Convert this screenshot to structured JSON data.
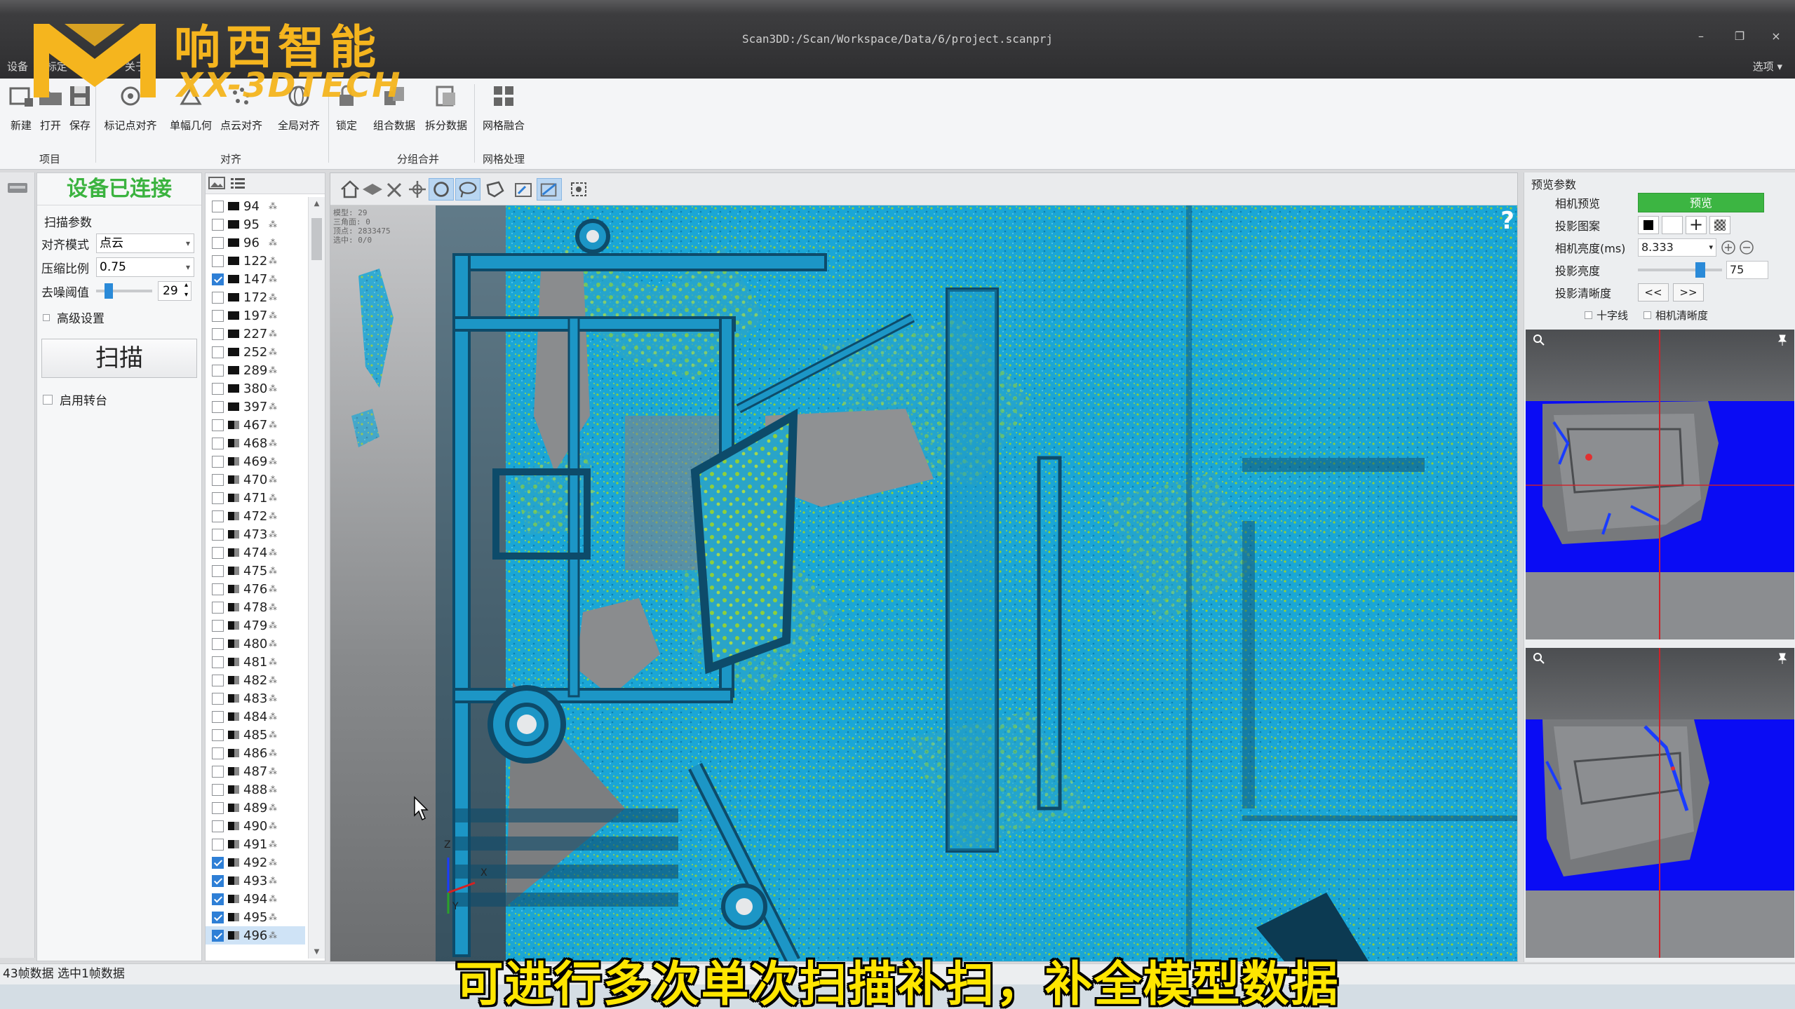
{
  "window": {
    "title": "Scan3DD:/Scan/Workspace/Data/6/project.scanprj",
    "options_label": "选项"
  },
  "menu_tabs": [
    "设备",
    "标定",
    "项目",
    "关于"
  ],
  "logo": {
    "cn": "响西智能",
    "en": "XX-3DTECH"
  },
  "ribbon": {
    "buttons": [
      "新建",
      "打开",
      "保存",
      "标记点对齐",
      "单幅几何",
      "点云对齐",
      "全局对齐",
      "锁定",
      "组合数据",
      "拆分数据",
      "网格融合"
    ],
    "groups": [
      "项目",
      "对齐",
      "分组合并",
      "网格处理"
    ]
  },
  "scan_panel": {
    "status": "设备已连接",
    "section_title": "扫描参数",
    "align_mode_label": "对齐模式",
    "align_mode_value": "点云",
    "compress_label": "压缩比例",
    "compress_value": "0.75",
    "denoise_label": "去噪阈值",
    "denoise_value": "29",
    "denoise_level": 0.15,
    "advanced_label": "高级设置",
    "scan_button": "扫描",
    "turntable_label": "启用转台"
  },
  "frames": [
    {
      "id": "94",
      "checked": false,
      "icon": "black"
    },
    {
      "id": "95",
      "checked": false,
      "icon": "black"
    },
    {
      "id": "96",
      "checked": false,
      "icon": "black"
    },
    {
      "id": "122",
      "checked": false,
      "icon": "black"
    },
    {
      "id": "147",
      "checked": true,
      "icon": "black"
    },
    {
      "id": "172",
      "checked": false,
      "icon": "black"
    },
    {
      "id": "197",
      "checked": false,
      "icon": "black"
    },
    {
      "id": "227",
      "checked": false,
      "icon": "black"
    },
    {
      "id": "252",
      "checked": false,
      "icon": "black"
    },
    {
      "id": "289",
      "checked": false,
      "icon": "black"
    },
    {
      "id": "380",
      "checked": false,
      "icon": "black"
    },
    {
      "id": "397",
      "checked": false,
      "icon": "black"
    },
    {
      "id": "467",
      "checked": false,
      "icon": "gray"
    },
    {
      "id": "468",
      "checked": false,
      "icon": "gray"
    },
    {
      "id": "469",
      "checked": false,
      "icon": "gray"
    },
    {
      "id": "470",
      "checked": false,
      "icon": "gray"
    },
    {
      "id": "471",
      "checked": false,
      "icon": "gray"
    },
    {
      "id": "472",
      "checked": false,
      "icon": "gray"
    },
    {
      "id": "473",
      "checked": false,
      "icon": "gray"
    },
    {
      "id": "474",
      "checked": false,
      "icon": "gray"
    },
    {
      "id": "475",
      "checked": false,
      "icon": "gray"
    },
    {
      "id": "476",
      "checked": false,
      "icon": "gray"
    },
    {
      "id": "478",
      "checked": false,
      "icon": "gray"
    },
    {
      "id": "479",
      "checked": false,
      "icon": "gray"
    },
    {
      "id": "480",
      "checked": false,
      "icon": "gray"
    },
    {
      "id": "481",
      "checked": false,
      "icon": "gray"
    },
    {
      "id": "482",
      "checked": false,
      "icon": "gray"
    },
    {
      "id": "483",
      "checked": false,
      "icon": "gray"
    },
    {
      "id": "484",
      "checked": false,
      "icon": "gray"
    },
    {
      "id": "485",
      "checked": false,
      "icon": "gray"
    },
    {
      "id": "486",
      "checked": false,
      "icon": "gray"
    },
    {
      "id": "487",
      "checked": false,
      "icon": "gray"
    },
    {
      "id": "488",
      "checked": false,
      "icon": "gray"
    },
    {
      "id": "489",
      "checked": false,
      "icon": "gray"
    },
    {
      "id": "490",
      "checked": false,
      "icon": "gray"
    },
    {
      "id": "491",
      "checked": false,
      "icon": "gray"
    },
    {
      "id": "492",
      "checked": true,
      "icon": "gray"
    },
    {
      "id": "493",
      "checked": true,
      "icon": "gray"
    },
    {
      "id": "494",
      "checked": true,
      "icon": "gray"
    },
    {
      "id": "495",
      "checked": true,
      "icon": "gray"
    },
    {
      "id": "496",
      "checked": true,
      "icon": "gray",
      "selected": true
    }
  ],
  "viewport": {
    "stats": [
      "模型: 29",
      "三角面: 0",
      "顶点: 2833475",
      "选中: 0/0"
    ],
    "help": "?",
    "axis": {
      "z": "Z",
      "x": "X",
      "y": "Y"
    },
    "colors": {
      "scan": "#1aa6d6",
      "highlight": "#8ecf3a",
      "shadow": "#0c3a52"
    }
  },
  "preview_panel": {
    "title": "预览参数",
    "camera_preview_label": "相机预览",
    "preview_button": "预览",
    "pattern_label": "投影图案",
    "exposure_label": "相机亮度(ms)",
    "exposure_value": "8.333",
    "projector_brightness_label": "投影亮度",
    "projector_brightness_value": "75",
    "projector_clarity_label": "投影清晰度",
    "prev_button": "<<",
    "next_button": ">>",
    "crosshair_label": "十字线",
    "camera_clarity_label": "相机清晰度"
  },
  "status_bar": "43帧数据 选中1帧数据",
  "subtitle": "可进行多次单次扫描补扫，补全模型数据",
  "theme": {
    "status_green": "#3bb33f",
    "accent_blue": "#2e7fd6",
    "logo_yellow": "#f5b51e",
    "subtitle_yellow": "#ffe600"
  }
}
